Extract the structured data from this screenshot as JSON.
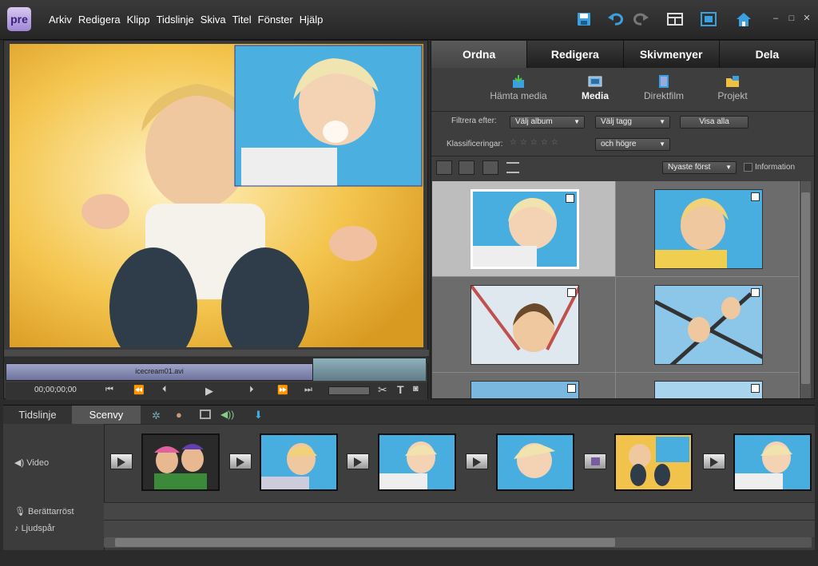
{
  "app": {
    "logo": "pre"
  },
  "menu": [
    "Arkiv",
    "Redigera",
    "Klipp",
    "Tidslinje",
    "Skiva",
    "Titel",
    "Fönster",
    "Hjälp"
  ],
  "toolbar": {
    "icons": [
      "save-icon",
      "undo-icon",
      "redo-icon",
      "layout-icon",
      "fullscreen-icon",
      "home-icon"
    ]
  },
  "monitor": {
    "clip_name": "icecream01.avi",
    "timecode": "00;00;00;00"
  },
  "organizer": {
    "tabs": [
      "Ordna",
      "Redigera",
      "Skivmenyer",
      "Dela"
    ],
    "active_tab": "Ordna",
    "subtabs": [
      "Hämta media",
      "Media",
      "Direktfilm",
      "Projekt"
    ],
    "active_subtab": "Media",
    "filter_label": "Filtrera efter:",
    "album_select": "Välj album",
    "tag_select": "Välj tagg",
    "show_all": "Visa alla",
    "rating_label": "Klassificeringar:",
    "rating_select": "och högre",
    "sort_select": "Nyaste först",
    "info_label": "Information"
  },
  "timeline": {
    "tabs": [
      "Tidslinje",
      "Scenvy"
    ],
    "active_tab": "Scenvy",
    "tracks": [
      "Video",
      "Berättarröst",
      "Ljudspår"
    ]
  }
}
